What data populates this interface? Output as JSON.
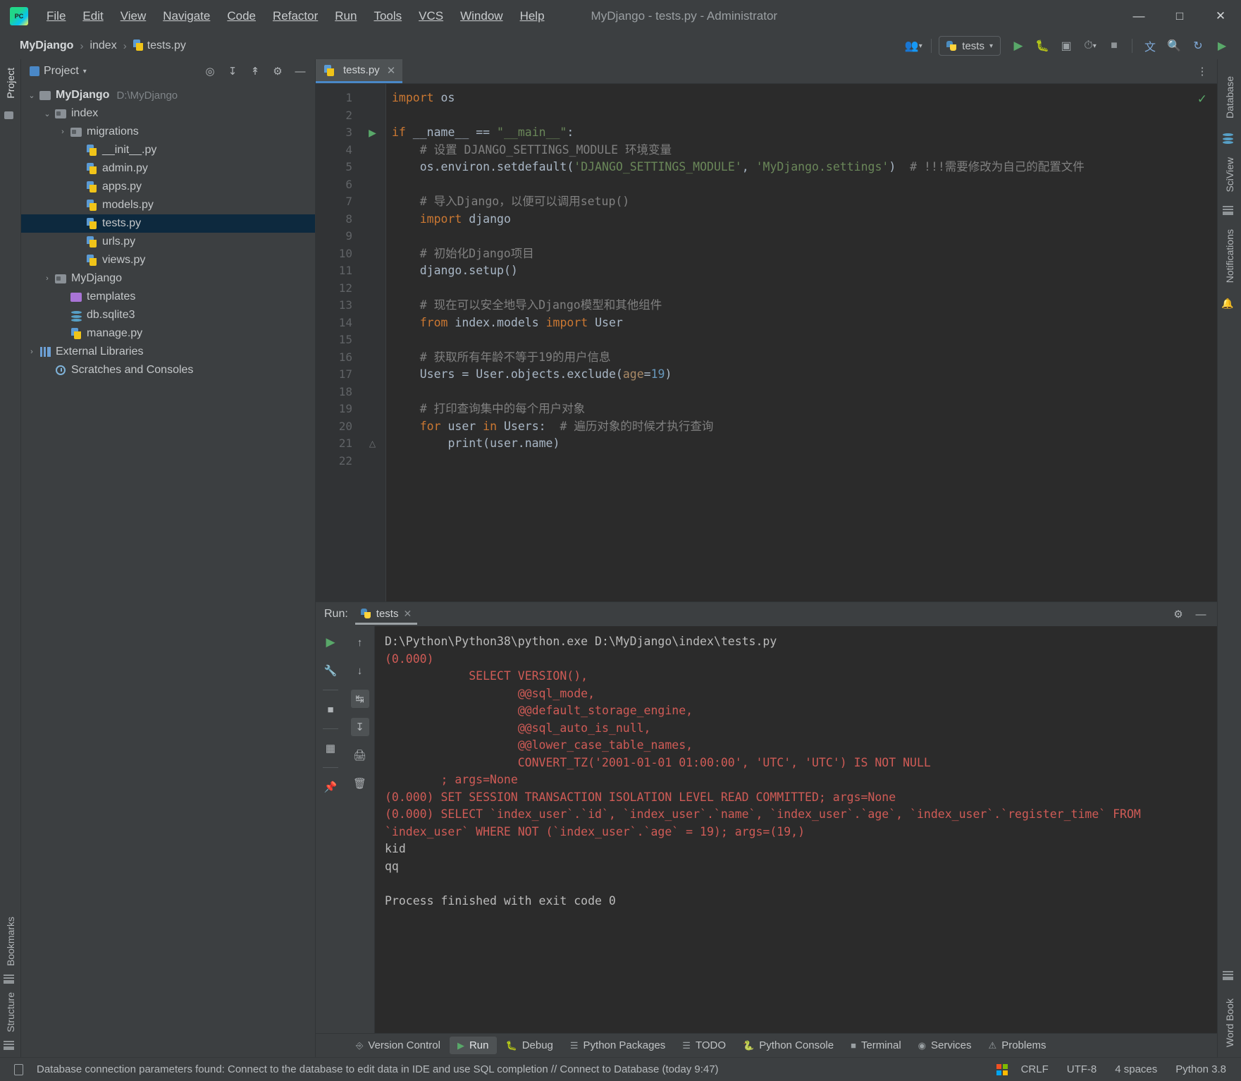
{
  "window": {
    "title": "MyDjango - tests.py - Administrator",
    "minimize": "─",
    "maximize": "☐",
    "close": "✕"
  },
  "menubar": {
    "items": [
      {
        "label": "File"
      },
      {
        "label": "Edit"
      },
      {
        "label": "View"
      },
      {
        "label": "Navigate"
      },
      {
        "label": "Code"
      },
      {
        "label": "Refactor"
      },
      {
        "label": "Run"
      },
      {
        "label": "Tools"
      },
      {
        "label": "VCS"
      },
      {
        "label": "Window"
      },
      {
        "label": "Help"
      }
    ]
  },
  "breadcrumb": {
    "items": [
      "MyDjango",
      "index",
      "tests.py"
    ],
    "separator": "›"
  },
  "toolbar": {
    "run_config": "tests",
    "icons": [
      "user-group-icon",
      "run-icon",
      "debug-icon",
      "coverage-icon",
      "profile-icon",
      "stop-icon",
      "translate-icon",
      "search-icon",
      "update-icon",
      "play-icon"
    ]
  },
  "project_panel": {
    "title": "Project",
    "tree": [
      {
        "depth": 0,
        "arrow": "⌄",
        "icon": "folder-icon",
        "label": "MyDjango",
        "bold": true,
        "path": "D:\\MyDjango"
      },
      {
        "depth": 1,
        "arrow": "⌄",
        "icon": "folder-src-icon",
        "label": "index",
        "bold": false,
        "path": ""
      },
      {
        "depth": 2,
        "arrow": "›",
        "icon": "folder-src-icon",
        "label": "migrations",
        "bold": false,
        "path": ""
      },
      {
        "depth": 3,
        "arrow": "",
        "icon": "python-file-icon",
        "label": "__init__.py",
        "bold": false,
        "path": ""
      },
      {
        "depth": 3,
        "arrow": "",
        "icon": "python-file-icon",
        "label": "admin.py",
        "bold": false,
        "path": ""
      },
      {
        "depth": 3,
        "arrow": "",
        "icon": "python-file-icon",
        "label": "apps.py",
        "bold": false,
        "path": ""
      },
      {
        "depth": 3,
        "arrow": "",
        "icon": "python-file-icon",
        "label": "models.py",
        "bold": false,
        "path": ""
      },
      {
        "depth": 3,
        "arrow": "",
        "icon": "python-file-icon",
        "label": "tests.py",
        "bold": false,
        "path": "",
        "selected": true
      },
      {
        "depth": 3,
        "arrow": "",
        "icon": "python-file-icon",
        "label": "urls.py",
        "bold": false,
        "path": ""
      },
      {
        "depth": 3,
        "arrow": "",
        "icon": "python-file-icon",
        "label": "views.py",
        "bold": false,
        "path": ""
      },
      {
        "depth": 1,
        "arrow": "›",
        "icon": "folder-src-icon",
        "label": "MyDjango",
        "bold": false,
        "path": ""
      },
      {
        "depth": 2,
        "arrow": "",
        "icon": "folder-template-icon",
        "label": "templates",
        "bold": false,
        "path": ""
      },
      {
        "depth": 2,
        "arrow": "",
        "icon": "database-file-icon",
        "label": "db.sqlite3",
        "bold": false,
        "path": ""
      },
      {
        "depth": 2,
        "arrow": "",
        "icon": "python-file-icon",
        "label": "manage.py",
        "bold": false,
        "path": ""
      },
      {
        "depth": 0,
        "arrow": "›",
        "icon": "library-icon",
        "label": "External Libraries",
        "bold": false,
        "path": ""
      },
      {
        "depth": 1,
        "arrow": "",
        "icon": "scratches-icon",
        "label": "Scratches and Consoles",
        "bold": false,
        "path": ""
      }
    ]
  },
  "editor": {
    "tab": "tests.py",
    "inspection_status": "✓",
    "lines": [
      {
        "n": 1,
        "marker": "",
        "fold": "",
        "tokens": [
          {
            "t": "import",
            "c": "kw"
          },
          {
            "t": " os",
            "c": "def"
          }
        ]
      },
      {
        "n": 2,
        "marker": "",
        "fold": "",
        "tokens": []
      },
      {
        "n": 3,
        "marker": "run",
        "fold": "start",
        "tokens": [
          {
            "t": "if",
            "c": "kw"
          },
          {
            "t": " __name__ ",
            "c": "def"
          },
          {
            "t": "==",
            "c": "def"
          },
          {
            "t": " ",
            "c": "def"
          },
          {
            "t": "\"__main__\"",
            "c": "str"
          },
          {
            "t": ":",
            "c": "def"
          }
        ]
      },
      {
        "n": 4,
        "marker": "",
        "fold": "",
        "tokens": [
          {
            "t": "    # 设置 DJANGO_SETTINGS_MODULE 环境变量",
            "c": "cmt"
          }
        ]
      },
      {
        "n": 5,
        "marker": "",
        "fold": "",
        "tokens": [
          {
            "t": "    os.environ.setdefault(",
            "c": "def"
          },
          {
            "t": "'DJANGO_SETTINGS_MODULE'",
            "c": "str"
          },
          {
            "t": ", ",
            "c": "def"
          },
          {
            "t": "'MyDjango.settings'",
            "c": "str"
          },
          {
            "t": ")  ",
            "c": "def"
          },
          {
            "t": "# !!!需要修改为自己的配置文件",
            "c": "cmt"
          }
        ]
      },
      {
        "n": 6,
        "marker": "",
        "fold": "",
        "tokens": []
      },
      {
        "n": 7,
        "marker": "",
        "fold": "",
        "tokens": [
          {
            "t": "    # 导入Django，以便可以调用setup()",
            "c": "cmt"
          }
        ]
      },
      {
        "n": 8,
        "marker": "",
        "fold": "",
        "tokens": [
          {
            "t": "    ",
            "c": "def"
          },
          {
            "t": "import",
            "c": "kw"
          },
          {
            "t": " django",
            "c": "def"
          }
        ]
      },
      {
        "n": 9,
        "marker": "",
        "fold": "",
        "tokens": []
      },
      {
        "n": 10,
        "marker": "",
        "fold": "",
        "tokens": [
          {
            "t": "    # 初始化Django项目",
            "c": "cmt"
          }
        ]
      },
      {
        "n": 11,
        "marker": "",
        "fold": "",
        "tokens": [
          {
            "t": "    django.setup()",
            "c": "def"
          }
        ]
      },
      {
        "n": 12,
        "marker": "",
        "fold": "",
        "tokens": []
      },
      {
        "n": 13,
        "marker": "",
        "fold": "",
        "tokens": [
          {
            "t": "    # 现在可以安全地导入Django模型和其他组件",
            "c": "cmt"
          }
        ]
      },
      {
        "n": 14,
        "marker": "",
        "fold": "",
        "tokens": [
          {
            "t": "    ",
            "c": "def"
          },
          {
            "t": "from",
            "c": "kw"
          },
          {
            "t": " index.models ",
            "c": "def"
          },
          {
            "t": "import",
            "c": "kw"
          },
          {
            "t": " User",
            "c": "def"
          }
        ]
      },
      {
        "n": 15,
        "marker": "",
        "fold": "",
        "tokens": []
      },
      {
        "n": 16,
        "marker": "",
        "fold": "",
        "tokens": [
          {
            "t": "    # 获取所有年龄不等于19的用户信息",
            "c": "cmt"
          }
        ]
      },
      {
        "n": 17,
        "marker": "",
        "fold": "",
        "tokens": [
          {
            "t": "    Users = User.objects.exclude(",
            "c": "def"
          },
          {
            "t": "age",
            "c": "param"
          },
          {
            "t": "=",
            "c": "def"
          },
          {
            "t": "19",
            "c": "num"
          },
          {
            "t": ")",
            "c": "def"
          }
        ]
      },
      {
        "n": 18,
        "marker": "",
        "fold": "",
        "tokens": []
      },
      {
        "n": 19,
        "marker": "",
        "fold": "",
        "tokens": [
          {
            "t": "    # 打印查询集中的每个用户对象",
            "c": "cmt"
          }
        ]
      },
      {
        "n": 20,
        "marker": "",
        "fold": "",
        "tokens": [
          {
            "t": "    ",
            "c": "def"
          },
          {
            "t": "for",
            "c": "kw"
          },
          {
            "t": " user ",
            "c": "def"
          },
          {
            "t": "in",
            "c": "kw"
          },
          {
            "t": " Users:  ",
            "c": "def"
          },
          {
            "t": "# 遍历对象的时候才执行查询",
            "c": "cmt"
          }
        ]
      },
      {
        "n": 21,
        "marker": "",
        "fold": "end",
        "tokens": [
          {
            "t": "        print(user.name)",
            "c": "def"
          }
        ]
      },
      {
        "n": 22,
        "marker": "",
        "fold": "",
        "tokens": []
      }
    ]
  },
  "run_panel": {
    "label": "Run:",
    "tab": "tests",
    "console": [
      {
        "text": "D:\\Python\\Python38\\python.exe D:\\MyDjango\\index\\tests.py",
        "color": "out"
      },
      {
        "text": "(0.000)",
        "color": "sql"
      },
      {
        "text": "            SELECT VERSION(),",
        "color": "sql"
      },
      {
        "text": "                   @@sql_mode,",
        "color": "sql"
      },
      {
        "text": "                   @@default_storage_engine,",
        "color": "sql"
      },
      {
        "text": "                   @@sql_auto_is_null,",
        "color": "sql"
      },
      {
        "text": "                   @@lower_case_table_names,",
        "color": "sql"
      },
      {
        "text": "                   CONVERT_TZ('2001-01-01 01:00:00', 'UTC', 'UTC') IS NOT NULL",
        "color": "sql"
      },
      {
        "text": "        ; args=None",
        "color": "sql"
      },
      {
        "text": "(0.000) SET SESSION TRANSACTION ISOLATION LEVEL READ COMMITTED; args=None",
        "color": "sql"
      },
      {
        "text": "(0.000) SELECT `index_user`.`id`, `index_user`.`name`, `index_user`.`age`, `index_user`.`register_time` FROM `index_user` WHERE NOT (`index_user`.`age` = 19); args=(19,)",
        "color": "sql"
      },
      {
        "text": "kid",
        "color": "out"
      },
      {
        "text": "qq",
        "color": "out"
      },
      {
        "text": "",
        "color": "out"
      },
      {
        "text": "Process finished with exit code 0",
        "color": "out"
      }
    ]
  },
  "tool_windows": [
    {
      "label": "Version Control",
      "icon": "branch-icon",
      "active": false
    },
    {
      "label": "Run",
      "icon": "play-icon",
      "active": true
    },
    {
      "label": "Debug",
      "icon": "bug-icon",
      "active": false
    },
    {
      "label": "Python Packages",
      "icon": "packages-icon",
      "active": false
    },
    {
      "label": "TODO",
      "icon": "list-icon",
      "active": false
    },
    {
      "label": "Python Console",
      "icon": "python-icon",
      "active": false
    },
    {
      "label": "Terminal",
      "icon": "terminal-icon",
      "active": false
    },
    {
      "label": "Services",
      "icon": "services-icon",
      "active": false
    },
    {
      "label": "Problems",
      "icon": "problems-icon",
      "active": false
    }
  ],
  "left_strips": [
    {
      "label": "Project",
      "active": true
    },
    {
      "label": "Bookmarks",
      "active": false
    },
    {
      "label": "Structure",
      "active": false
    }
  ],
  "right_strips": [
    {
      "label": "Database",
      "active": false
    },
    {
      "label": "SciView",
      "active": false
    },
    {
      "label": "Notifications",
      "active": false
    },
    {
      "label": "Word Book",
      "active": false
    }
  ],
  "statusbar": {
    "message": "Database connection parameters found: Connect to the database to edit data in IDE and use SQL completion // Connect to Database (today 9:47)",
    "line_sep": "CRLF",
    "encoding": "UTF-8",
    "indent": "4 spaces",
    "interpreter": "Python 3.8"
  },
  "colors": {
    "accent": "#4a88c7",
    "green": "#59a869",
    "sql_red": "#cf5b56",
    "editor_bg": "#2b2b2b",
    "panel_bg": "#3c3f41",
    "selection": "#0d293e"
  }
}
